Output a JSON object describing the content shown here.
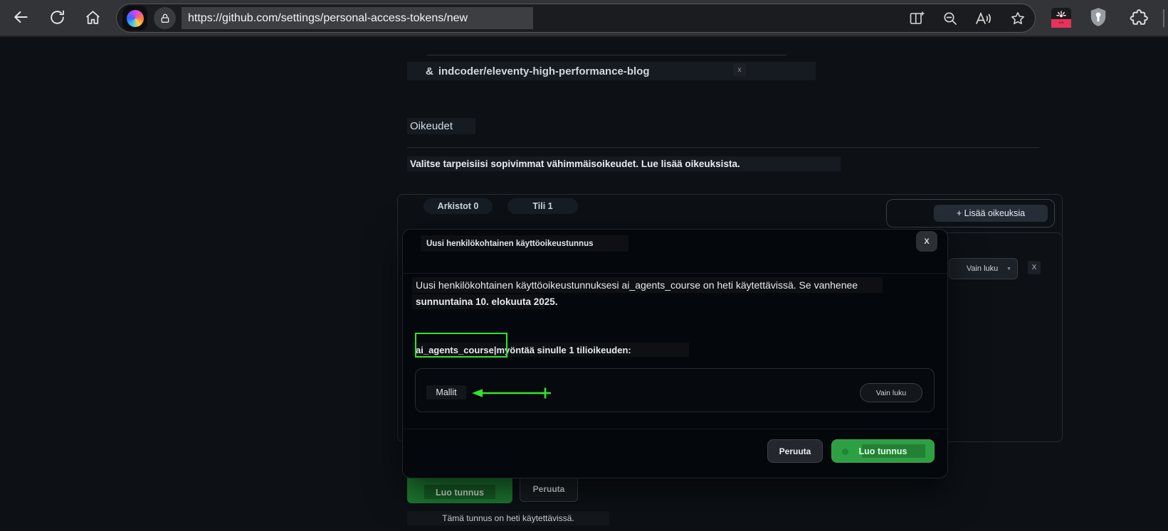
{
  "browser": {
    "url": "https://github.com/settings/personal-access-tokens/new",
    "toolbar_icons": [
      "back",
      "refresh",
      "home",
      "copilot",
      "lock",
      "split-screen",
      "zoom-out",
      "read-aloud",
      "favorites",
      "extension-red",
      "security-shield",
      "extensions"
    ]
  },
  "page": {
    "repo_chip": {
      "icon": "&",
      "name": "indcoder/eleventy-high-performance-blog",
      "remove": "x"
    },
    "heading": "Oikeudet",
    "description": "Valitse tarpeisiisi sopivimmat vähimmäisoikeudet. Lue lisää oikeuksista.",
    "tabs": [
      "Arkistot 0",
      "Tili 1"
    ],
    "add_permissions_button": "+ Lisää oikeuksia",
    "account_permission": {
      "access_value": "Vain luku",
      "remove": "X"
    },
    "create_button": "Luo tunnus",
    "cancel_button": "Peruuta",
    "note": "Tämä tunnus on heti käytettävissä."
  },
  "modal": {
    "title": "Uusi henkilökohtainen käyttöoikeustunnus",
    "close": "X",
    "body_line1": "Uusi henkilökohtainen käyttöoikeustunnuksesi ai_agents_course on heti käytettävissä. Se vanhenee",
    "body_line2": "sunnuntaina 10. elokuuta 2025.",
    "token_name": "ai_agents_course",
    "separator": "|",
    "grant_text": "myöntää sinulle 1 tilioikeuden:",
    "permission_label": "Mallit",
    "permission_access": "Vain luku",
    "cancel_button": "Peruuta",
    "create_button": "Luo tunnus"
  },
  "colors": {
    "github_green": "#2ea043",
    "annotation_green": "#2ee62e",
    "page_bg": "#0d1116",
    "toolbar_bg": "#333438"
  }
}
